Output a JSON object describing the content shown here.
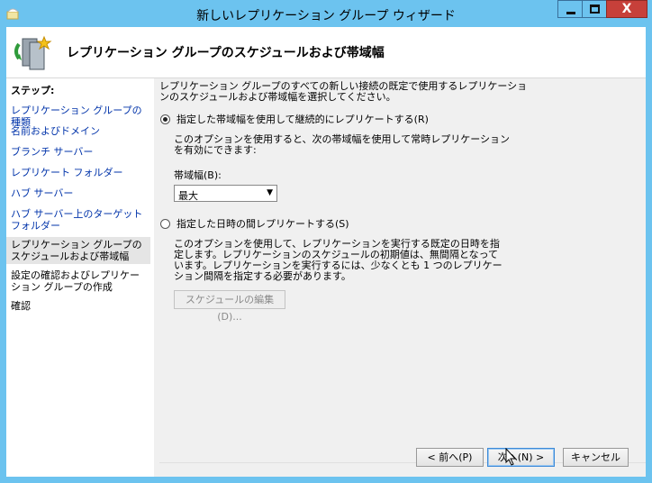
{
  "window": {
    "title": "新しいレプリケーション グループ ウィザード",
    "controls": {
      "minimize": "–",
      "maximize": "□",
      "close": "X"
    }
  },
  "header": {
    "title": "レプリケーション グループのスケジュールおよび帯域幅"
  },
  "steps": {
    "title": "ステップ:",
    "items": [
      {
        "label": "レプリケーション グループの種類"
      },
      {
        "label": "名前およびドメイン"
      },
      {
        "label": "ブランチ サーバー"
      },
      {
        "label": "レプリケート フォルダー"
      },
      {
        "label": "ハブ サーバー"
      },
      {
        "label": "ハブ サーバー上のターゲット フォルダー"
      },
      {
        "label": "レプリケーション グループのスケジュールおよび帯域幅"
      },
      {
        "label": "設定の確認およびレプリケーション グループの作成"
      },
      {
        "label": "確認"
      }
    ]
  },
  "content": {
    "intro": "レプリケーション グループのすべての新しい接続の既定で使用するレプリケーションのスケジュールおよび帯域幅を選択してください。",
    "option1": {
      "label": "指定した帯域幅を使用して継続的にレプリケートする(R)",
      "selected": true,
      "description": "このオプションを使用すると、次の帯域幅を使用して常時レプリケーションを有効にできます:",
      "bandwidth_label": "帯域幅(B):",
      "bandwidth_value": "最大"
    },
    "option2": {
      "label": "指定した日時の間レプリケートする(S)",
      "selected": false,
      "description": "このオプションを使用して、レプリケーションを実行する既定の日時を指定します。レプリケーションのスケジュールの初期値は、無間隔となっています。レプリケーションを実行するには、少なくとも 1 つのレプリケーション間隔を指定する必要があります。",
      "edit_schedule": "スケジュールの編集(D)..."
    }
  },
  "footer": {
    "back": "< 前へ(P)",
    "next": "次へ(N) >",
    "cancel": "キャンセル"
  }
}
